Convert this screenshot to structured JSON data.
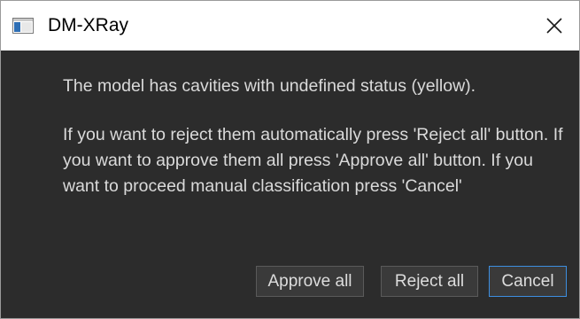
{
  "window": {
    "title": "DM-XRay"
  },
  "dialog": {
    "message_line1": "The model has cavities with undefined status (yellow).",
    "message_line2": "If you want to reject them automatically press 'Reject all' button. If you want to approve them all press 'Approve all' button. If you want to proceed manual classification press 'Cancel'"
  },
  "buttons": {
    "approve_all": "Approve all",
    "reject_all": "Reject all",
    "cancel": "Cancel"
  },
  "colors": {
    "dialog_background": "#2c2c2c",
    "text": "#dadada",
    "button_background": "#3a3a3a",
    "default_button_border": "#3d8ee0"
  },
  "icons": {
    "app": "window-app-icon",
    "close": "close-icon"
  }
}
